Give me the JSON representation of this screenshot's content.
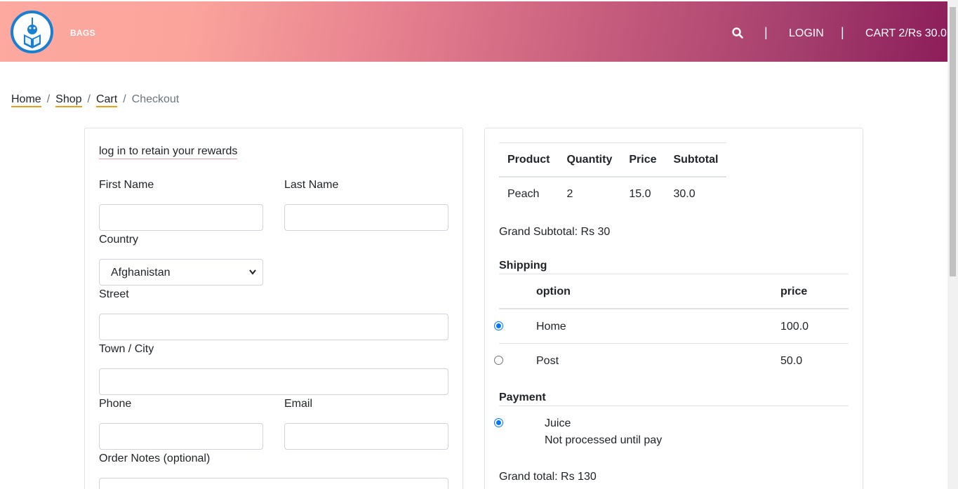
{
  "header": {
    "brand": "BAGS",
    "login_label": "LOGIN",
    "cart_label": "CART 2/Rs 30.0",
    "separator": "|"
  },
  "breadcrumb": {
    "items": [
      "Home",
      "Shop",
      "Cart"
    ],
    "active": "Checkout",
    "separator": "/"
  },
  "form": {
    "rewards_link": "log in to retain your rewards",
    "first_name_label": "First Name",
    "last_name_label": "Last Name",
    "country_label": "Country",
    "country_value": "Afghanistan",
    "street_label": "Street",
    "town_label": "Town / City",
    "phone_label": "Phone",
    "email_label": "Email",
    "notes_label": "Order Notes (optional)"
  },
  "order": {
    "columns": [
      "Product",
      "Quantity",
      "Price",
      "Subtotal"
    ],
    "rows": [
      {
        "product": "Peach",
        "quantity": "2",
        "price": "15.0",
        "subtotal": "30.0"
      }
    ],
    "grand_subtotal": "Grand Subtotal: Rs 30",
    "shipping_title": "Shipping",
    "shipping_columns": [
      "option",
      "price"
    ],
    "shipping_options": [
      {
        "option": "Home",
        "price": "100.0",
        "selected": true
      },
      {
        "option": "Post",
        "price": "50.0",
        "selected": false
      }
    ],
    "payment_title": "Payment",
    "payment_option": "Juice",
    "payment_note": "Not processed until pay",
    "grand_total": "Grand total: Rs 130"
  }
}
